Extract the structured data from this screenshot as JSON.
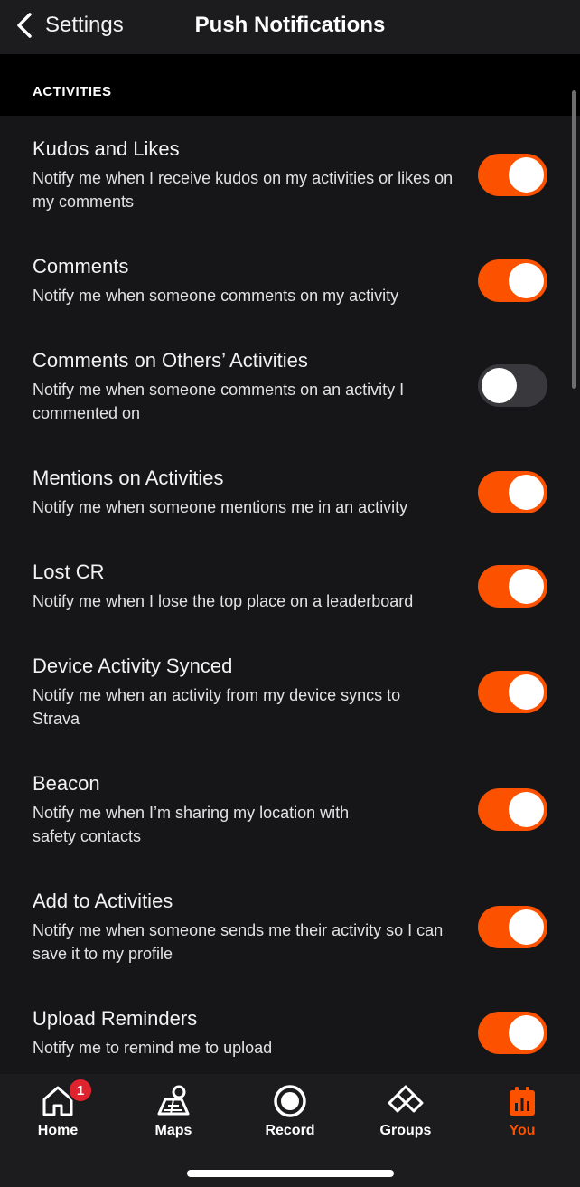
{
  "header": {
    "back_label": "Settings",
    "title": "Push Notifications"
  },
  "section": {
    "title": "ACTIVITIES"
  },
  "settings": [
    {
      "title": "Kudos and Likes",
      "description": "Notify me when I receive kudos on my activities or likes on my comments",
      "enabled": true
    },
    {
      "title": "Comments",
      "description": "Notify me when someone comments on my activity",
      "enabled": true
    },
    {
      "title": "Comments on Others’ Activities",
      "description": "Notify me when someone comments on an activity I commented on",
      "enabled": false
    },
    {
      "title": "Mentions on Activities",
      "description": "Notify me when someone mentions me in an activity",
      "enabled": true
    },
    {
      "title": "Lost CR",
      "description": "Notify me when I lose the top place on a leaderboard",
      "enabled": true
    },
    {
      "title": "Device Activity Synced",
      "description": "Notify me when an activity from my device syncs to Strava",
      "enabled": true
    },
    {
      "title": "Beacon",
      "description": "Notify me when I’m sharing my location with safety contacts",
      "enabled": true
    },
    {
      "title": "Add to Activities",
      "description": "Notify me when someone sends me their activity so I can save it to my profile",
      "enabled": true
    },
    {
      "title": "Upload Reminders",
      "description": "Notify me to remind me to upload",
      "enabled": true
    }
  ],
  "tabbar": {
    "home": {
      "label": "Home",
      "badge": "1",
      "icon": "home-icon"
    },
    "maps": {
      "label": "Maps",
      "icon": "map-icon"
    },
    "record": {
      "label": "Record",
      "icon": "record-icon"
    },
    "groups": {
      "label": "Groups",
      "icon": "groups-icon"
    },
    "you": {
      "label": "You",
      "icon": "profile-chart-icon"
    }
  },
  "colors": {
    "accent": "#fc5200",
    "toggle_off": "#39383c",
    "background": "#161517",
    "badge": "#e0242f"
  }
}
